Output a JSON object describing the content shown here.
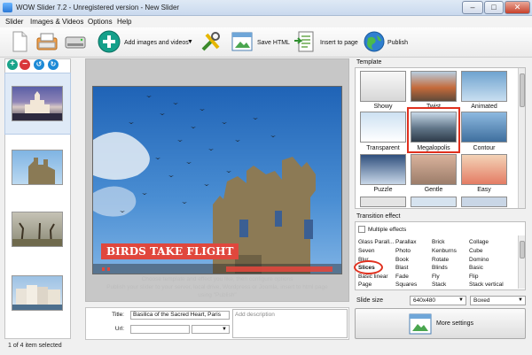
{
  "window": {
    "title": "WOW Slider 7.2 - Unregistered version - New Slider",
    "min_label": "–",
    "max_label": "□",
    "close_label": "✕"
  },
  "menu": [
    "Slider",
    "Images & Videos",
    "Options",
    "Help"
  ],
  "toolbar": {
    "add_label": "Add images and videos",
    "save_html_label": "Save HTML",
    "insert_label": "Insert to page",
    "publish_label": "Publish",
    "icons": [
      "new-document-icon",
      "open-icon",
      "save-drive-icon",
      "add-circle-icon",
      "dropdown-arrow-icon",
      "settings-tools-icon",
      "save-html-icon",
      "insert-page-icon",
      "publish-globe-icon"
    ]
  },
  "slides": {
    "count_status": "1 of 4 item selected",
    "items": [
      "Basilica slide",
      "Ruins slide",
      "Trees slide",
      "Townhouses slide"
    ]
  },
  "preview": {
    "caption": "BIRDS TAKE FLIGHT",
    "hint_line1": "Choose template and effect you like, then configure options",
    "hint_line2": "Publish your slider to your server, local drive, Wordpress or Joomla, insert to html page",
    "hint_line3": "using \"Publish\""
  },
  "details": {
    "title_label": "Title:",
    "title_value": "Basilica of the Sacred Heart, Paris",
    "url_label": "Url:",
    "url_value": "",
    "description_placeholder": "Add description"
  },
  "templates": {
    "group_label": "Template",
    "items": [
      "Showy",
      "Twist",
      "Animated",
      "Transparent",
      "Megalopolis",
      "Contour",
      "Puzzle",
      "Gentle",
      "Easy"
    ],
    "selected": "Megalopolis"
  },
  "effects": {
    "group_label": "Transition effect",
    "multiple_label": "Multiple effects",
    "columns": [
      [
        "Glass Parall...",
        "Seven",
        "Blur",
        "Slices",
        "Basic linear",
        "Page"
      ],
      [
        "Parallax",
        "Photo",
        "Book",
        "Blast",
        "Fade",
        "Squares"
      ],
      [
        "Brick",
        "Kenburns",
        "Rotate",
        "Blinds",
        "Fly",
        "Stack"
      ],
      [
        "Collage",
        "Cube",
        "Domino",
        "Basic",
        "Flip",
        "Stack vertical"
      ]
    ],
    "selected": "Slices"
  },
  "slide_size": {
    "label": "Slide size",
    "value": "640x480",
    "mode": "Boxed"
  },
  "more_settings_label": "More settings",
  "colors": {
    "accent_red": "#e0301e",
    "caption_red": "#e0473d",
    "selection_blue": "#dfeaf7"
  }
}
